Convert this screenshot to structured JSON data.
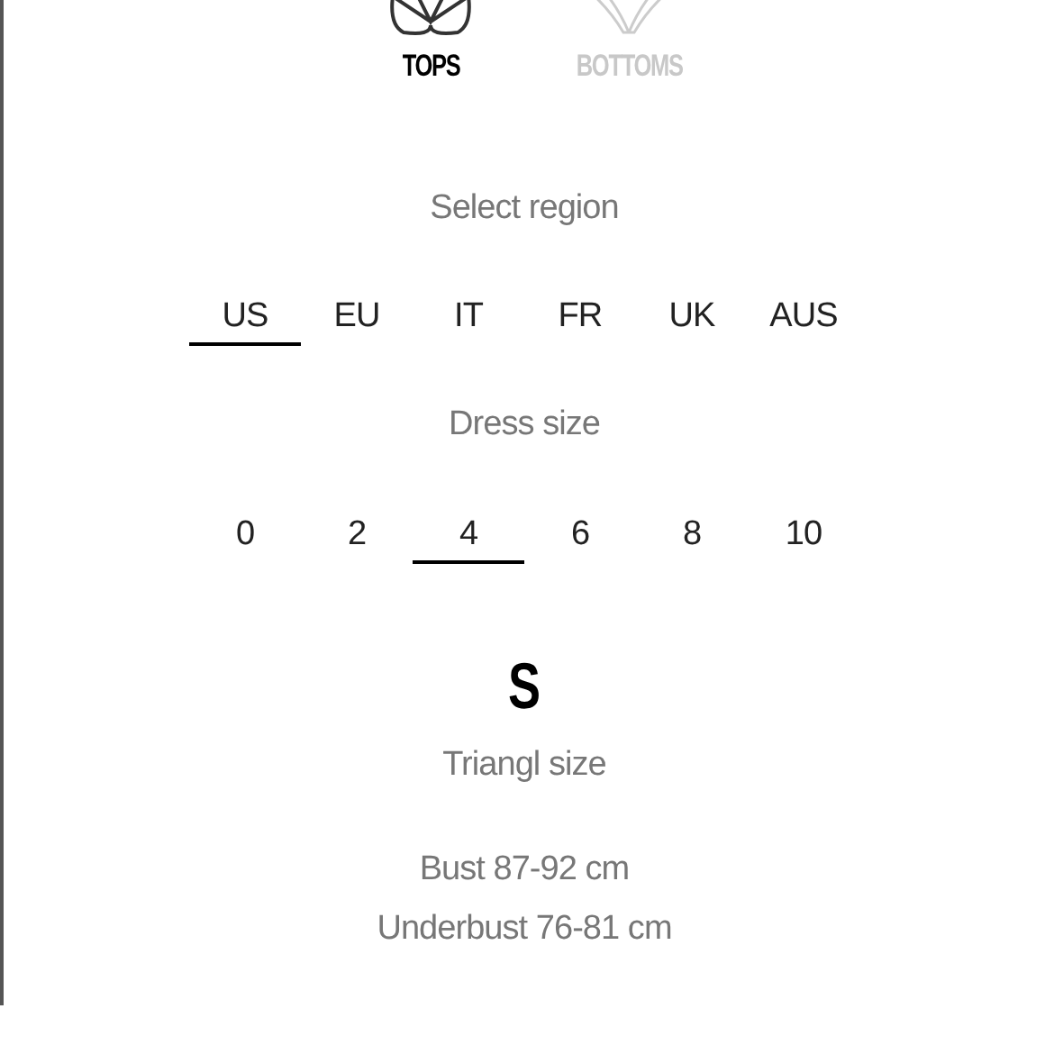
{
  "categories": [
    {
      "label": "TOPS",
      "kind": "top",
      "selected": true
    },
    {
      "label": "BOTTOMS",
      "kind": "bottom",
      "selected": false
    }
  ],
  "region": {
    "heading": "Select region",
    "options": [
      {
        "label": "US",
        "selected": true
      },
      {
        "label": "EU",
        "selected": false
      },
      {
        "label": "IT",
        "selected": false
      },
      {
        "label": "FR",
        "selected": false
      },
      {
        "label": "UK",
        "selected": false
      },
      {
        "label": "AUS",
        "selected": false
      }
    ]
  },
  "dress_size": {
    "heading": "Dress size",
    "options": [
      {
        "label": "0",
        "selected": false
      },
      {
        "label": "2",
        "selected": false
      },
      {
        "label": "4",
        "selected": true
      },
      {
        "label": "6",
        "selected": false
      },
      {
        "label": "8",
        "selected": false
      },
      {
        "label": "10",
        "selected": false
      }
    ]
  },
  "result": {
    "size": "S",
    "caption": "Triangl size",
    "measurements": [
      "Bust 87-92 cm",
      "Underbust 76-81 cm"
    ]
  }
}
